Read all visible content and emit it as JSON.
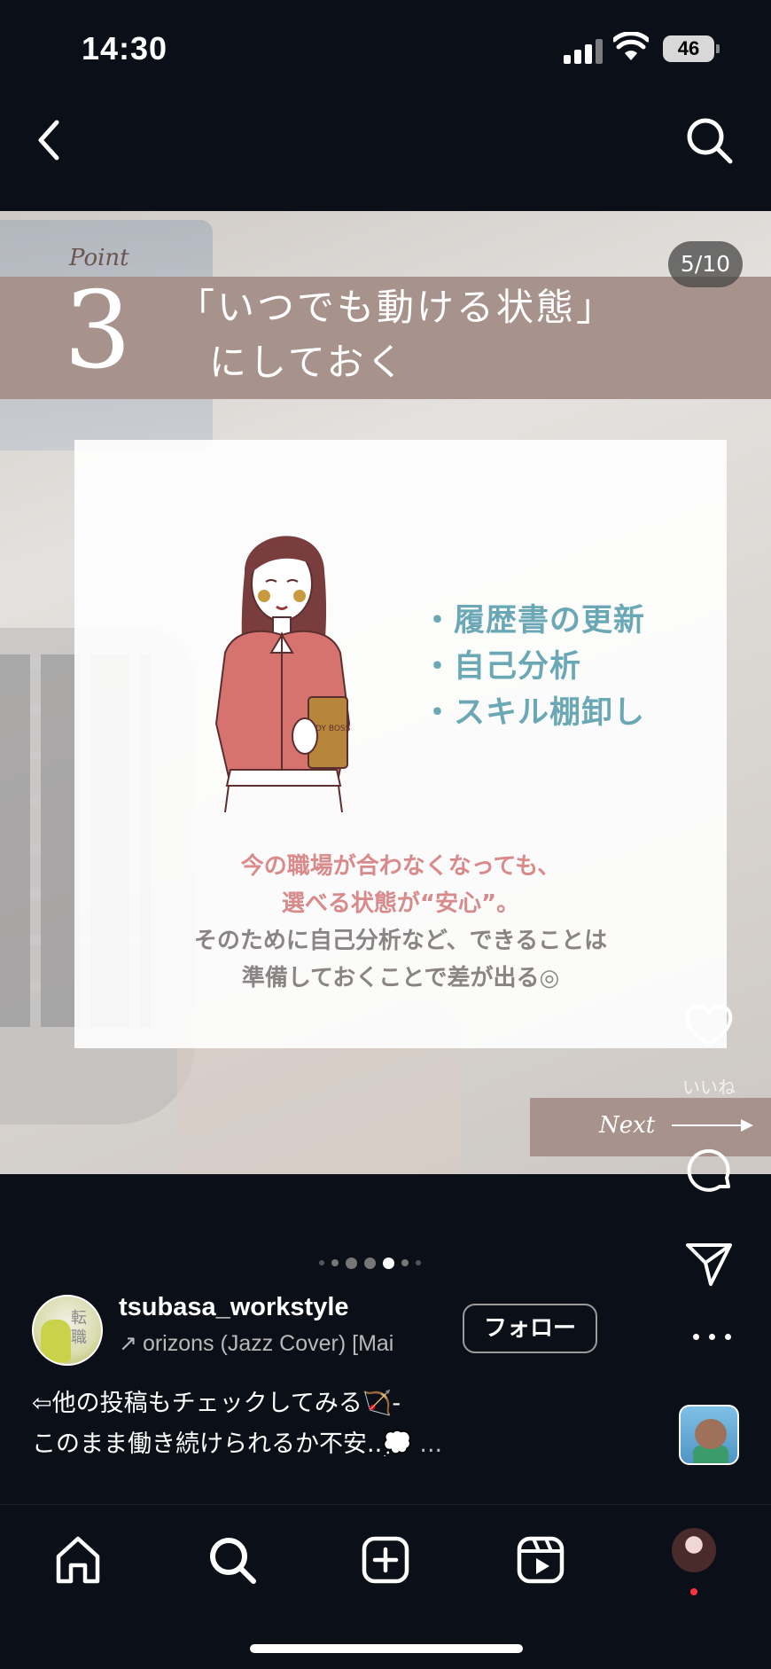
{
  "status_bar": {
    "time": "14:30",
    "battery": "46"
  },
  "post": {
    "point_label": "Point",
    "point_number": "3",
    "title_line1": "「いつでも動ける状態」",
    "title_line2": "にしておく",
    "slide_counter": "5/10",
    "bullets": [
      "履歴書の更新",
      "自己分析",
      "スキル棚卸し"
    ],
    "caption_pink_1": "今の職場が合わなくなっても、",
    "caption_pink_2": "選べる状態が“安心”。",
    "caption_grey_1": "そのために自己分析など、できることは",
    "caption_grey_2": "準備しておくことで差が出る◎",
    "illustration_cup_text": "LADY BOSS",
    "next_label": "Next",
    "carousel_total": 7,
    "carousel_active": 4
  },
  "actions": {
    "like_label": "いいね"
  },
  "user": {
    "username": "tsubasa_workstyle",
    "avatar_text": "転職",
    "music": "orizons (Jazz Cover) [Mai",
    "follow_label": "フォロー"
  },
  "caption": {
    "line1": "⇦他の投稿もチェックしてみる🏹-",
    "line2": "このまま働き続けられるか不安..💭",
    "more": "..."
  },
  "icons": [
    "back-arrow-icon",
    "search-icon",
    "heart-icon",
    "comment-icon",
    "share-icon",
    "more-icon",
    "home-icon",
    "explore-icon",
    "create-icon",
    "reels-icon"
  ]
}
